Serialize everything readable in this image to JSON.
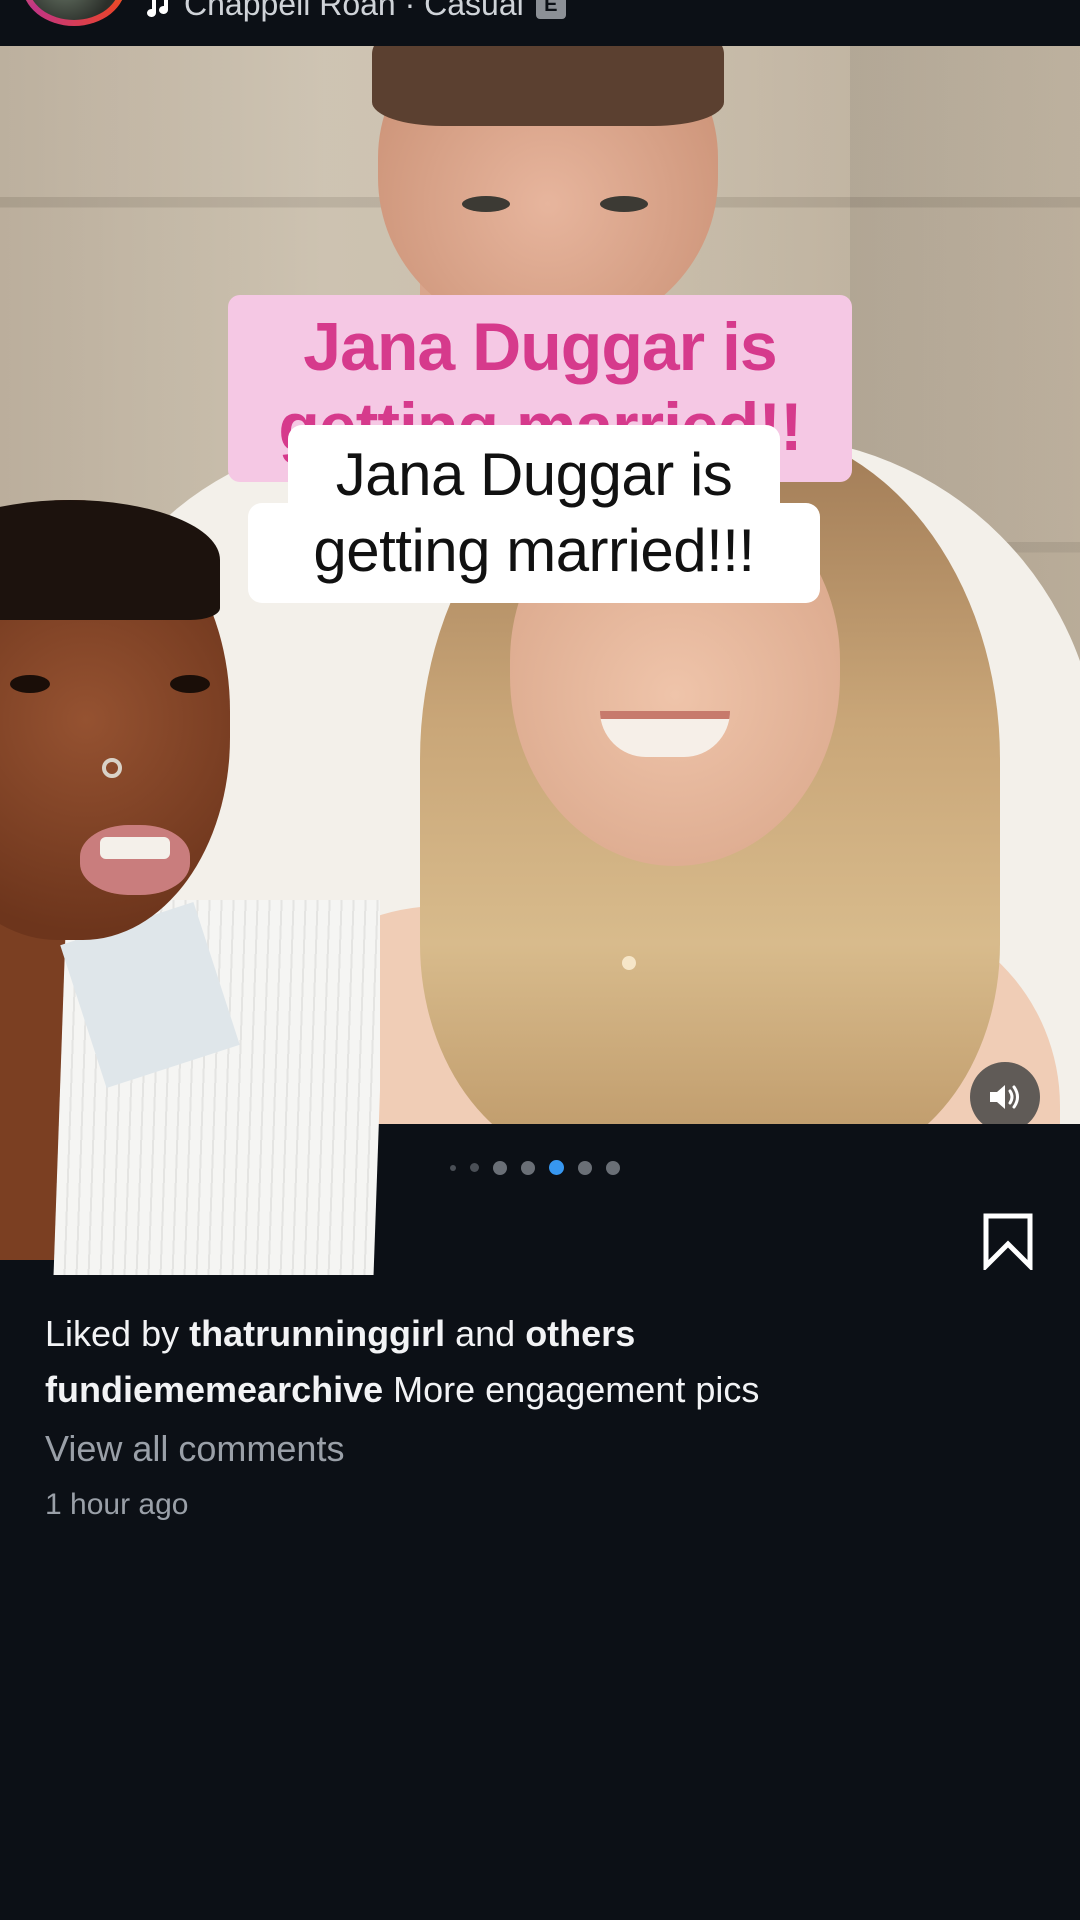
{
  "header": {
    "music_text": "Chappell Roan · Casual",
    "explicit_badge": "E"
  },
  "photo": {
    "overlay_pink_text": "Jana Duggar is getting married!!",
    "overlay_black_text_line1": "Jana Duggar is",
    "overlay_black_text_line2": "getting married!!!",
    "volume_icon": "speaker-icon"
  },
  "carousel": {
    "dot_count": 7,
    "active_index": 4
  },
  "actions": {
    "bookmark_icon": "bookmark-icon"
  },
  "post": {
    "liked_by_prefix": "Liked by",
    "liked_by_user": "thatrunninggirl",
    "liked_by_and": "and",
    "liked_by_others": "others",
    "author": "fundiememearchive",
    "caption": "More engagement pics",
    "view_comments": "View all comments",
    "time_ago": "1 hour ago"
  },
  "colors": {
    "background": "#0c1016",
    "pink_overlay": "#f5c8e4",
    "pink_text": "#d63a8c",
    "active_dot": "#3797f0"
  }
}
